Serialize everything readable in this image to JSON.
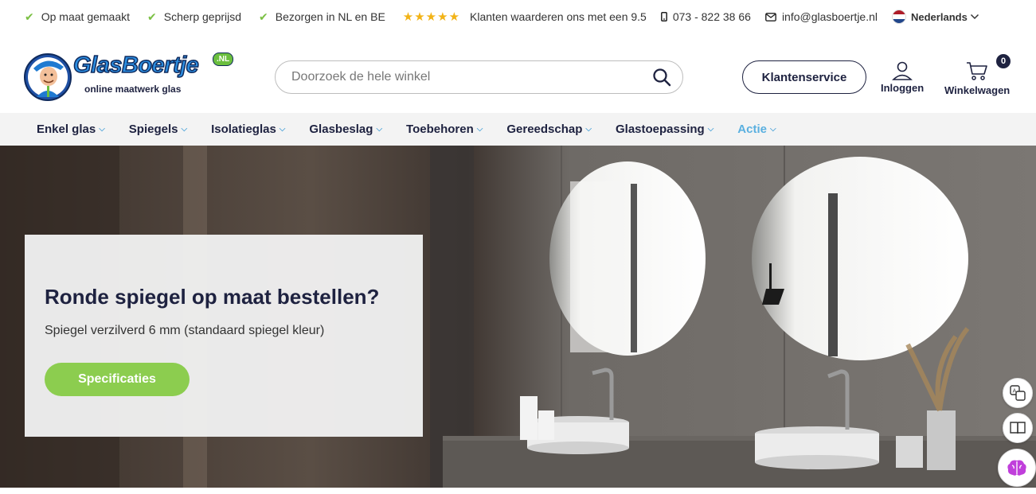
{
  "topbar": {
    "usps": [
      "Op maat gemaakt",
      "Scherp geprijsd",
      "Bezorgen in NL en BE"
    ],
    "stars": "★★★★★",
    "rating_text": "Klanten waarderen ons met een 9.5",
    "phone": "073 - 822 38 66",
    "email": "info@glasboertje.nl",
    "language": "Nederlands"
  },
  "header": {
    "logo_text": "GlasBoertje",
    "logo_badge": ".NL",
    "logo_tagline": "online maatwerk glas",
    "search_placeholder": "Doorzoek de hele winkel",
    "customer_service": "Klantenservice",
    "login": "Inloggen",
    "cart": "Winkelwagen",
    "cart_count": "0"
  },
  "nav": {
    "items": [
      "Enkel glas",
      "Spiegels",
      "Isolatieglas",
      "Glasbeslag",
      "Toebehoren",
      "Gereedschap",
      "Glastoepassing",
      "Actie"
    ]
  },
  "hero": {
    "title": "Ronde spiegel op maat bestellen?",
    "subtitle": "Spiegel verzilverd 6 mm (standaard spiegel kleur)",
    "button": "Specificaties"
  },
  "colors": {
    "navy": "#1e2240",
    "green": "#8ccd4f",
    "accent_blue": "#5ab0e0",
    "star": "#f2b316"
  }
}
